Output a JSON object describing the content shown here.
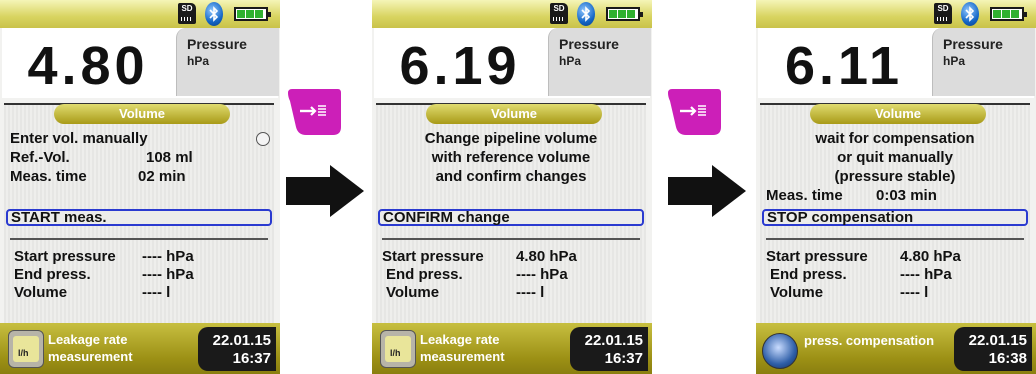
{
  "screens": [
    {
      "reading": "4.80",
      "label": "Pressure",
      "unit": "hPa",
      "tab": "Volume",
      "lines": [
        "Enter vol. manually",
        "Ref.-Vol.",
        "108 ml",
        "Meas. time",
        "02 min"
      ],
      "selected": "START meas.",
      "results": [
        {
          "label": "Start pressure",
          "value": "---- hPa"
        },
        {
          "label": "End press.",
          "value": "---- hPa"
        },
        {
          "label": "Volume",
          "value": "---- l"
        }
      ],
      "footer": {
        "line1": "Leakage rate",
        "line2": "measurement",
        "date": "22.01.15",
        "time": "16:37",
        "icon": "leakage-rate-icon"
      }
    },
    {
      "reading": "6.19",
      "label": "Pressure",
      "unit": "hPa",
      "tab": "Volume",
      "lines": [
        "Change pipeline volume",
        "with reference volume",
        "and confirm changes"
      ],
      "selected": "CONFIRM change",
      "results": [
        {
          "label": "Start pressure",
          "value": "4.80 hPa"
        },
        {
          "label": "End press.",
          "value": "---- hPa"
        },
        {
          "label": "Volume",
          "value": "---- l"
        }
      ],
      "footer": {
        "line1": "Leakage rate",
        "line2": "measurement",
        "date": "22.01.15",
        "time": "16:37",
        "icon": "leakage-rate-icon"
      }
    },
    {
      "reading": "6.11",
      "label": "Pressure",
      "unit": "hPa",
      "tab": "Volume",
      "lines": [
        "wait for compensation",
        "or quit manually",
        "(pressure stable)",
        "Meas. time",
        "0:03 min"
      ],
      "selected": "STOP compensation",
      "results": [
        {
          "label": "Start pressure",
          "value": "4.80 hPa"
        },
        {
          "label": "End press.",
          "value": "---- hPa"
        },
        {
          "label": "Volume",
          "value": "---- l"
        }
      ],
      "footer": {
        "line1": "press. compensation",
        "date": "22.01.15",
        "time": "16:38",
        "icon": "compensation-icon"
      }
    }
  ],
  "status": {
    "sd": "SD",
    "battery_level": 1.0,
    "icons": [
      "sd-card-icon",
      "bluetooth-icon",
      "battery-icon"
    ]
  },
  "connector_icons": [
    "enter-key-icon",
    "right-arrow-icon"
  ],
  "colors": {
    "topbar": "#d8d460",
    "select_border": "#2a3ad0",
    "key_magenta": "#cc1fb8",
    "bottombar": "#9c9015"
  }
}
